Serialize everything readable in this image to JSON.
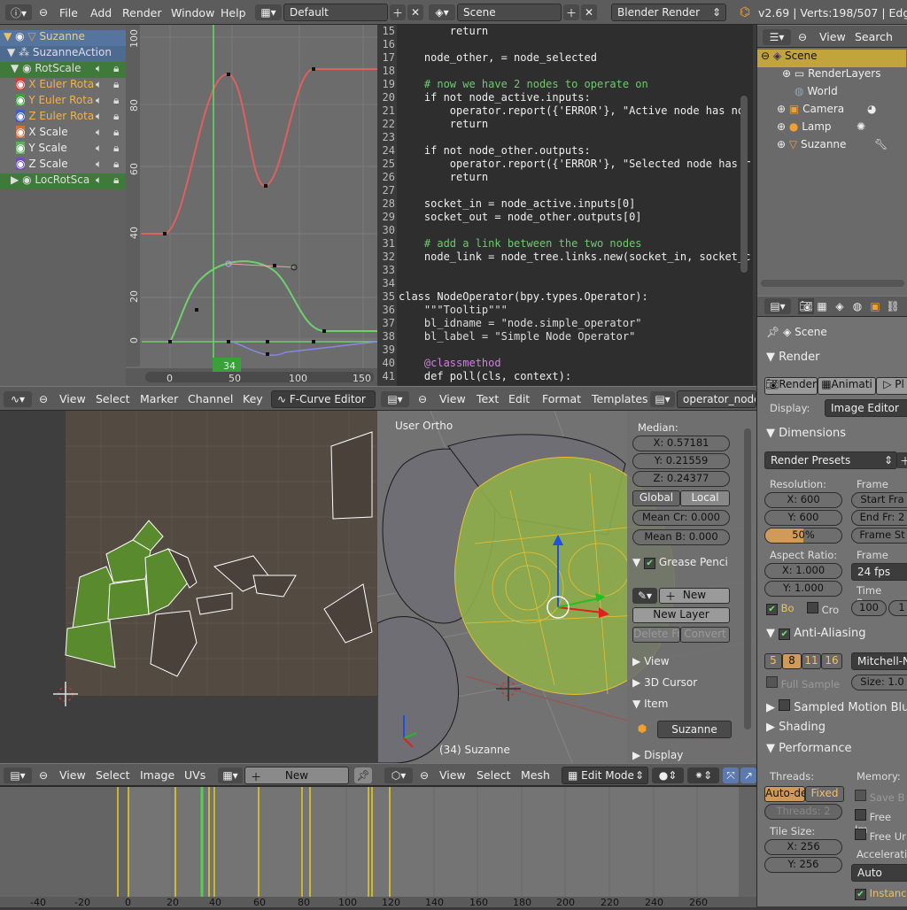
{
  "topbar": {
    "menus": [
      "File",
      "Add",
      "Render",
      "Window",
      "Help"
    ],
    "screen_layout": "Default",
    "scene": "Scene",
    "engine": "Blender Render",
    "stats": "v2.69 | Verts:198/507 | Edge"
  },
  "fcurve": {
    "channels": [
      "Suzanne",
      "SuzanneAction",
      "RotScale",
      "X Euler Rota",
      "Y Euler Rota",
      "Z Euler Rota",
      "X Scale",
      "Y Scale",
      "Z Scale",
      "LocRotSca"
    ],
    "y_ticks": [
      "100",
      "80",
      "60",
      "40",
      "20",
      "0"
    ],
    "x_ticks": [
      "0",
      "50",
      "100",
      "150"
    ],
    "current_frame": "34",
    "header_menus": [
      "View",
      "Select",
      "Marker",
      "Channel",
      "Key"
    ],
    "editor_mode": "F-Curve Editor"
  },
  "text_editor": {
    "line_numbers": [
      "15",
      "16",
      "17",
      "18",
      "19",
      "20",
      "21",
      "22",
      "23",
      "24",
      "25",
      "26",
      "27",
      "28",
      "29",
      "30",
      "31",
      "32",
      "33",
      "34",
      "35",
      "36",
      "37",
      "38",
      "39",
      "40",
      "41"
    ],
    "lines": [
      "        return",
      "",
      "    node_other, = node_selected",
      "",
      "    # now we have 2 nodes to operate on",
      "    if not node_active.inputs:",
      "        operator.report({'ERROR'}, \"Active node has no",
      "        return",
      "",
      "    if not node_other.outputs:",
      "        operator.report({'ERROR'}, \"Selected node has r",
      "        return",
      "",
      "    socket_in = node_active.inputs[0]",
      "    socket_out = node_other.outputs[0]",
      "",
      "    # add a link between the two nodes",
      "    node_link = node_tree.links.new(socket_in, socket_c",
      "",
      "",
      "class NodeOperator(bpy.types.Operator):",
      "    \"\"\"Tooltip\"\"\"",
      "    bl_idname = \"node.simple_operator\"",
      "    bl_label = \"Simple Node Operator\"",
      "",
      "    @classmethod",
      "    def poll(cls, context):"
    ],
    "header_menus": [
      "View",
      "Text",
      "Edit",
      "Format",
      "Templates"
    ],
    "filename": "operator_node"
  },
  "outliner": {
    "header_menus": [
      "View",
      "Search"
    ],
    "items": [
      "Scene",
      "RenderLayers",
      "World",
      "Camera",
      "Lamp",
      "Suzanne"
    ]
  },
  "uv_editor": {
    "header_menus": [
      "View",
      "Select",
      "Image",
      "UVs"
    ],
    "new_label": "New"
  },
  "viewport": {
    "label": "User Ortho",
    "object_label": "(34) Suzanne",
    "header_menus": [
      "View",
      "Select",
      "Mesh"
    ],
    "mode": "Edit Mode",
    "n_panel": {
      "median_label": "Median:",
      "x": "X: 0.57181",
      "y": "Y: 0.21559",
      "z": "Z: 0.24377",
      "global": "Global",
      "local": "Local",
      "mean_cr": "Mean Cr: 0.000",
      "mean_b": "Mean B: 0.000",
      "grease_pencil": "Grease Penci",
      "new": "New",
      "new_layer": "New Layer",
      "delete_fr": "Delete Fr",
      "convert": "Convert",
      "view": "View",
      "cursor": "3D Cursor",
      "item": "Item",
      "item_name": "Suzanne",
      "display": "Display"
    }
  },
  "properties": {
    "context": "Scene",
    "render_header": "Render",
    "render_btn": "Render",
    "anim_btn": "Animati",
    "play_btn": "Pl",
    "display_label": "Display:",
    "display_value": "Image Editor",
    "dimensions": "Dimensions",
    "render_presets": "Render Presets",
    "resolution": "Resolution:",
    "frame_range": "Frame Ran",
    "res_x": "X: 600",
    "res_y": "Y: 600",
    "res_pct": "50%",
    "res_pct_value": 50,
    "start_fr": "Start Fra",
    "end_fr": "End Fr: 2",
    "frame_st": "Frame St",
    "aspect": "Aspect Ratio:",
    "frame_rate": "Frame Rat",
    "asp_x": "X: 1.000",
    "asp_y": "Y: 1.000",
    "fps": "24 fps",
    "time_rem": "Time Rem",
    "bo": "Bo",
    "cro": "Cro",
    "t100": "100",
    "t1": "1",
    "aa": "Anti-Aliasing",
    "aa_samples": [
      "5",
      "8",
      "11",
      "16"
    ],
    "aa_filter": "Mitchell-Ne",
    "full_sample": "Full Sample",
    "size": "Size: 1.0",
    "smb": "Sampled Motion Blur",
    "shading": "Shading",
    "performance": "Performance",
    "threads": "Threads:",
    "memory": "Memory:",
    "auto_detect": "Auto-de",
    "fixed": "Fixed",
    "save_b": "Save B",
    "threads_n": "Threads: 2",
    "free_im": "Free Im",
    "free_un": "Free Ur",
    "tile_size": "Tile Size:",
    "tile_x": "X: 256",
    "tile_y": "Y: 256",
    "acceleration": "Acceleratio",
    "auto": "Auto",
    "instance": "Instanc"
  },
  "timeline": {
    "ticks": [
      "-40",
      "-20",
      "0",
      "20",
      "40",
      "60",
      "80",
      "100",
      "120",
      "140",
      "160",
      "180",
      "200",
      "220",
      "240",
      "260"
    ]
  },
  "colors": {
    "accent_orange": "#e8a040",
    "green_selected": "#4a8a2a",
    "red_curve": "#e05050",
    "green_curve": "#70d070"
  }
}
